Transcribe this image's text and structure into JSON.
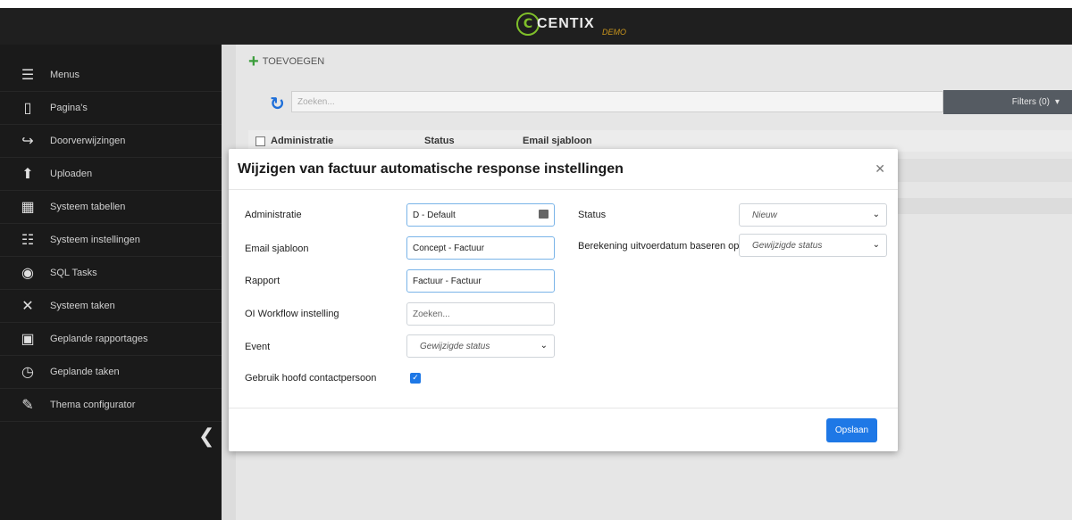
{
  "header": {
    "logo_text": "CENTIX",
    "logo_mark": "C",
    "logo_sub": "DEMO"
  },
  "sidebar": {
    "items": [
      {
        "label": "Menus",
        "icon": "hamburger-icon"
      },
      {
        "label": "Pagina's",
        "icon": "page-icon"
      },
      {
        "label": "Doorverwijzingen",
        "icon": "redirect-icon"
      },
      {
        "label": "Uploaden",
        "icon": "upload-icon"
      },
      {
        "label": "Systeem tabellen",
        "icon": "table-icon"
      },
      {
        "label": "Systeem instellingen",
        "icon": "sliders-icon"
      },
      {
        "label": "SQL Tasks",
        "icon": "database-icon"
      },
      {
        "label": "Systeem taken",
        "icon": "tools-icon"
      },
      {
        "label": "Geplande rapportages",
        "icon": "calendar-check-icon"
      },
      {
        "label": "Geplande taken",
        "icon": "stopwatch-icon"
      },
      {
        "label": "Thema configurator",
        "icon": "brush-icon"
      }
    ]
  },
  "main": {
    "add_label": "TOEVOEGEN",
    "search_placeholder": "Zoeken...",
    "filters_label": "Filters (0)",
    "columns": [
      "Administratie",
      "Status",
      "Email sjabloon"
    ]
  },
  "modal": {
    "title": "Wijzigen van factuur automatische response instellingen",
    "fields": {
      "administratie": {
        "label": "Administratie",
        "value": "D - Default"
      },
      "email_sjabloon": {
        "label": "Email sjabloon",
        "value": "Concept - Factuur"
      },
      "rapport": {
        "label": "Rapport",
        "value": "Factuur - Factuur"
      },
      "oi_workflow": {
        "label": "OI Workflow instelling",
        "placeholder": "Zoeken..."
      },
      "event": {
        "label": "Event",
        "value": "Gewijzigde status"
      },
      "gebruik_hoofd": {
        "label": "Gebruik hoofd contactpersoon",
        "checked": true
      },
      "status": {
        "label": "Status",
        "value": "Nieuw"
      },
      "berekening": {
        "label": "Berekening uitvoerdatum baseren op",
        "value": "Gewijzigde status"
      }
    },
    "save_label": "Opslaan"
  },
  "colors": {
    "accent": "#1e78e6",
    "sidebar_bg": "#1a1a1a",
    "topbar_bg": "#1f1f1f",
    "add_green": "#3a9d3a"
  }
}
